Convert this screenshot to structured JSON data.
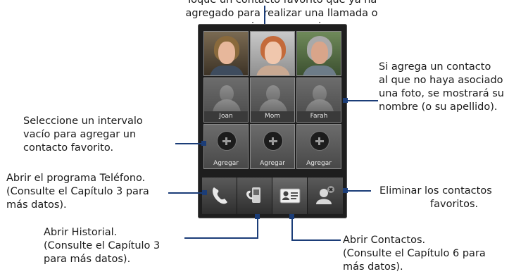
{
  "top_annotation": "Toque un contacto favorito que ya ha agregado para realizar una llamada o enviar un mensaje.",
  "annotations": {
    "empty_slot": [
      "Seleccione un intervalo",
      "vacío para agregar un",
      "contacto favorito."
    ],
    "phone_program": [
      "Abrir el programa Teléfono.",
      "(Consulte el Capítulo 3 para",
      "más datos)."
    ],
    "history": [
      "Abrir Historial.",
      "(Consulte el Capítulo 3",
      "para más datos)."
    ],
    "contacts": [
      "Abrir Contactos.",
      "(Consulte el Capítulo 6 para",
      "más datos)."
    ],
    "delete": [
      "Eliminar los contactos",
      "favoritos."
    ],
    "no_photo": [
      "Si agrega un contacto",
      "al que no haya asociado",
      "una foto, se mostrará su",
      "nombre (o su apellido)."
    ]
  },
  "contacts_row2": [
    "Joan",
    "Mom",
    "Farah"
  ],
  "add_label": "Agregar",
  "icons": [
    "phone-icon",
    "history-icon",
    "contacts-card-icon",
    "delete-contact-icon",
    "silhouette-icon",
    "add-plus-icon"
  ],
  "colors": {
    "callout_line": "#1b3d78",
    "device_bg": "#1e1e1e"
  }
}
